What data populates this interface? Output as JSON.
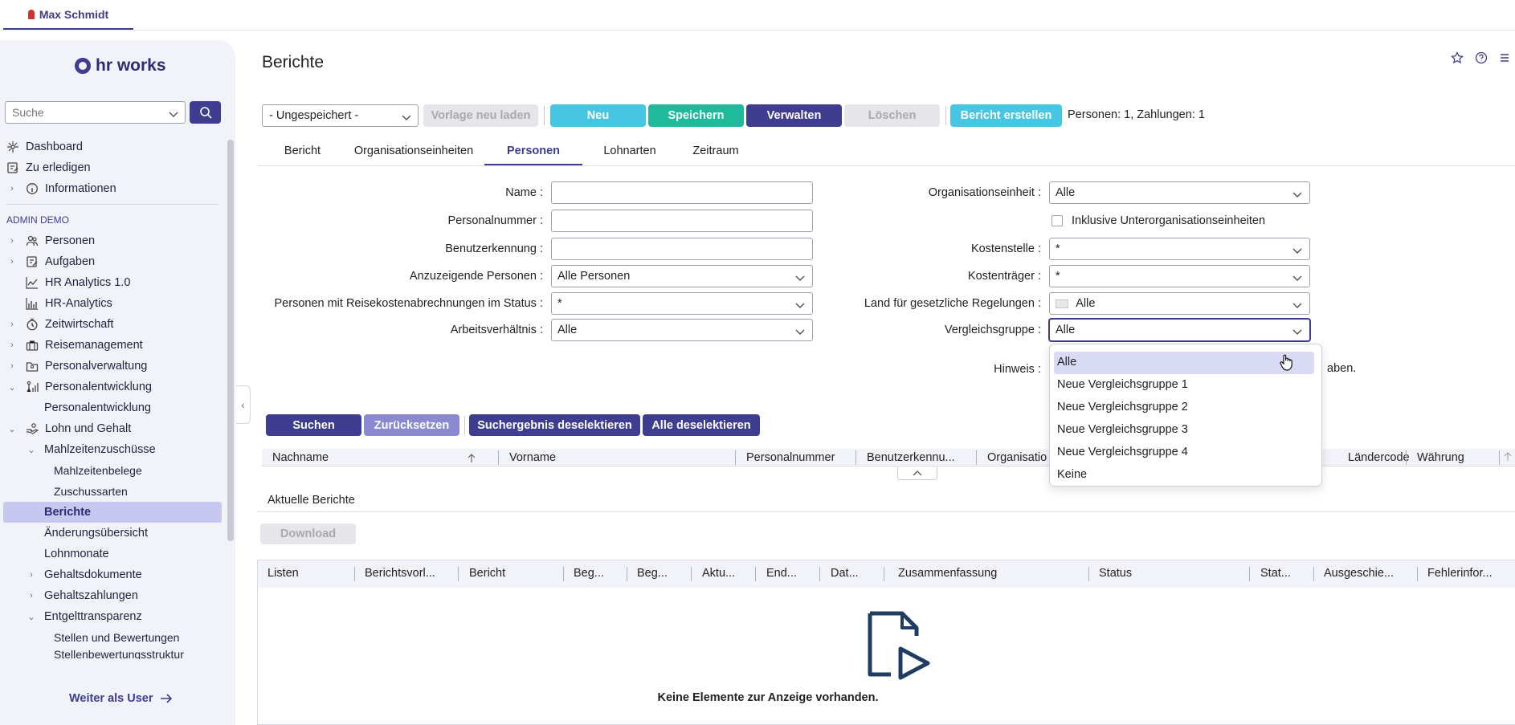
{
  "topbar": {
    "user_name": "Max Schmidt"
  },
  "sidebar": {
    "logo_text": "hr works",
    "search_placeholder": "Suche",
    "top_items": [
      {
        "label": "Dashboard"
      },
      {
        "label": "Zu erledigen"
      },
      {
        "label": "Informationen"
      }
    ],
    "section_label": "ADMIN DEMO",
    "items": [
      {
        "label": "Personen"
      },
      {
        "label": "Aufgaben"
      },
      {
        "label": "HR Analytics 1.0"
      },
      {
        "label": "HR-Analytics"
      },
      {
        "label": "Zeitwirtschaft"
      },
      {
        "label": "Reisemanagement"
      },
      {
        "label": "Personalverwaltung"
      },
      {
        "label": "Personalentwicklung"
      },
      {
        "label": "Personalentwicklung"
      },
      {
        "label": "Lohn und Gehalt"
      },
      {
        "label": "Mahlzeitenzuschüsse"
      },
      {
        "label": "Mahlzeitenbelege"
      },
      {
        "label": "Zuschussarten"
      },
      {
        "label": "Berichte"
      },
      {
        "label": "Änderungsübersicht"
      },
      {
        "label": "Lohnmonate"
      },
      {
        "label": "Gehaltsdokumente"
      },
      {
        "label": "Gehaltszahlungen"
      },
      {
        "label": "Entgelttransparenz"
      },
      {
        "label": "Stellen und Bewertungen"
      },
      {
        "label": "Stellenbewertungsstruktur"
      }
    ],
    "continue_label": "Weiter als User"
  },
  "page": {
    "title": "Berichte"
  },
  "toolbar": {
    "template_select": "- Ungespeichert -",
    "reload_label": "Vorlage neu laden",
    "new_label": "Neu",
    "save_label": "Speichern",
    "manage_label": "Verwalten",
    "delete_label": "Löschen",
    "create_label": "Bericht erstellen",
    "status": "Personen: 1, Zahlungen: 1"
  },
  "tabs": [
    {
      "label": "Bericht"
    },
    {
      "label": "Organisationseinheiten"
    },
    {
      "label": "Personen"
    },
    {
      "label": "Lohnarten"
    },
    {
      "label": "Zeitraum"
    }
  ],
  "form": {
    "name_label": "Name :",
    "name_value": "",
    "persnr_label": "Personalnummer :",
    "persnr_value": "",
    "userid_label": "Benutzerkennung :",
    "userid_value": "",
    "show_persons_label": "Anzuzeigende Personen :",
    "show_persons_value": "Alle Personen",
    "travel_status_label": "Personen mit Reisekostenabrechnungen im Status :",
    "travel_status_value": "*",
    "employment_label": "Arbeitsverhältnis :",
    "employment_value": "Alle",
    "orgunit_label": "Organisationseinheit :",
    "orgunit_value": "Alle",
    "include_sub_label": "Inklusive Unterorganisationseinheiten",
    "costcenter_label": "Kostenstelle :",
    "costcenter_value": "*",
    "costunit_label": "Kostenträger :",
    "costunit_value": "*",
    "country_label": "Land für gesetzliche Regelungen :",
    "country_value": "Alle",
    "compgroup_label": "Vergleichsgruppe :",
    "compgroup_value": "Alle",
    "hint_label": "Hinweis :",
    "hint_tail": "aben."
  },
  "dropdown": {
    "options": [
      {
        "label": "Alle"
      },
      {
        "label": "Neue Vergleichsgruppe 1"
      },
      {
        "label": "Neue Vergleichsgruppe 2"
      },
      {
        "label": "Neue Vergleichsgruppe 3"
      },
      {
        "label": "Neue Vergleichsgruppe 4"
      },
      {
        "label": "Keine"
      }
    ],
    "selected_index": 0
  },
  "search_buttons": {
    "search_label": "Suchen",
    "reset_label": "Zurücksetzen",
    "deselect_results_label": "Suchergebnis deselektieren",
    "deselect_all_label": "Alle deselektieren"
  },
  "persons_table": {
    "columns": [
      "Nachname",
      "Vorname",
      "Personalnummer",
      "Benutzerkennu...",
      "Organisatio",
      "Ländercode",
      "Währung"
    ]
  },
  "reports": {
    "title": "Aktuelle Berichte",
    "download_label": "Download",
    "columns": [
      "Listen",
      "Berichtsvorl...",
      "Bericht",
      "Beg...",
      "Beg...",
      "Aktu...",
      "End...",
      "Dat...",
      "Zusammenfassung",
      "Status",
      "Stat...",
      "Ausgeschie...",
      "Fehlerinfor..."
    ],
    "empty_text": "Keine Elemente zur Anzeige vorhanden."
  },
  "colors": {
    "brand": "#3f3d8f",
    "new_button": "#47c6e4",
    "save_button": "#1fb99b",
    "sidebar_bg": "#f2f3f8",
    "active_nav": "#c6c8f0"
  }
}
